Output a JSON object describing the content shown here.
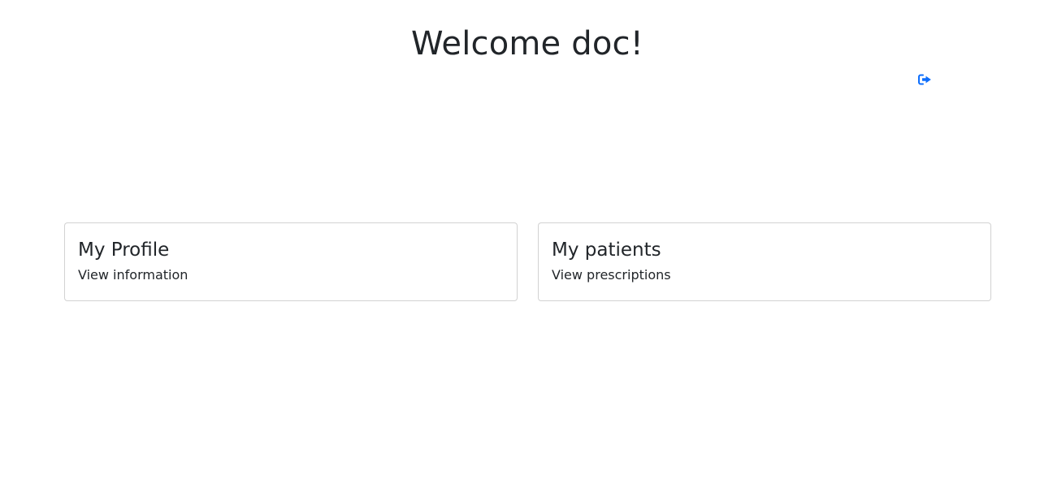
{
  "header": {
    "title": "Welcome doc!",
    "logout_icon": "sign-out-icon",
    "accent_color": "#0d6efd"
  },
  "cards": [
    {
      "title": "My Profile",
      "text": "View information"
    },
    {
      "title": "My patients",
      "text": "View prescriptions"
    }
  ]
}
